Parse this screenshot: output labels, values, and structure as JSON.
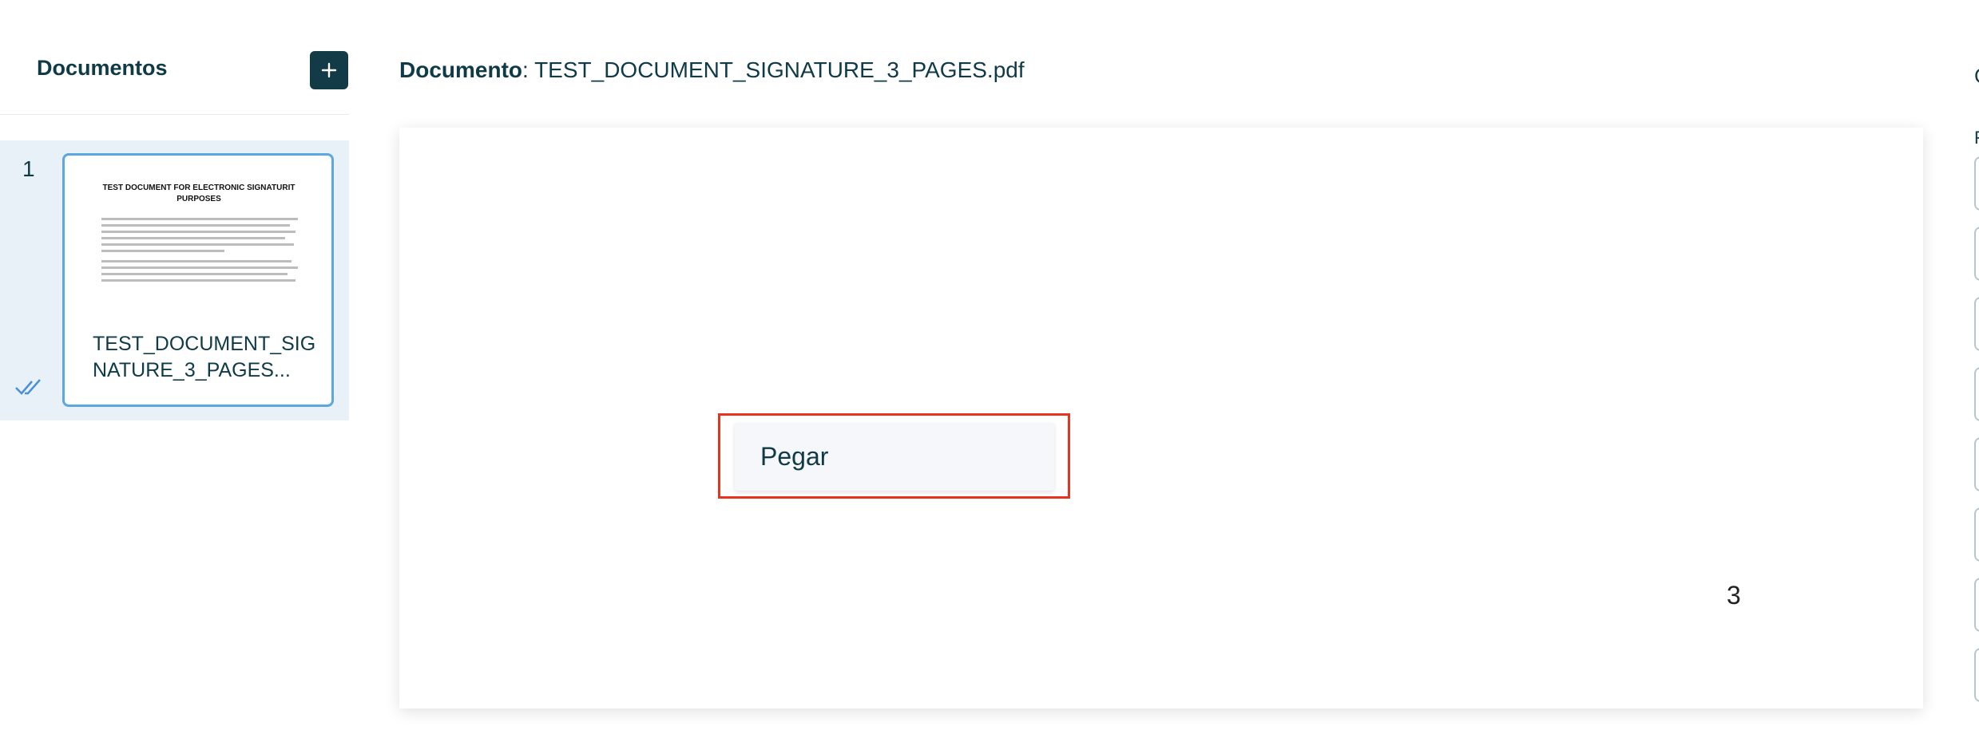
{
  "sidebar": {
    "title": "Documentos",
    "add_icon": "plus-icon",
    "documents": [
      {
        "index": "1",
        "name": "TEST_DOCUMENT_SIGNATURE_3_PAGES...",
        "thumbnail_title": "TEST DOCUMENT FOR ELECTRONIC SIGNATURIT PURPOSES",
        "status_icon": "double-check-icon"
      }
    ]
  },
  "header": {
    "label": "Documento",
    "separator": ": ",
    "filename": "TEST_DOCUMENT_SIGNATURE_3_PAGES.pdf"
  },
  "page": {
    "number": "3"
  },
  "context_menu": {
    "items": [
      "Pegar"
    ]
  },
  "right_panel": {
    "heading_initial": "C",
    "subheading_initial": "F"
  },
  "colors": {
    "accent": "#123b47",
    "selected_row": "#e8f0f8",
    "card_border": "#5ba8e0",
    "highlight": "#e8331d"
  }
}
